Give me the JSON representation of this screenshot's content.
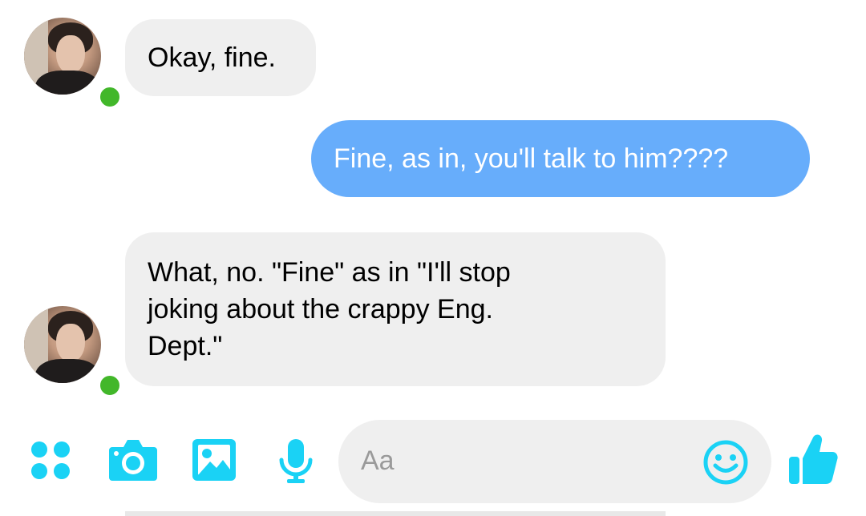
{
  "messages": [
    {
      "direction": "in",
      "text": "Okay, fine."
    },
    {
      "direction": "out",
      "text": "Fine, as in, you'll talk to him????"
    },
    {
      "direction": "in",
      "text": "What, no. \"Fine\" as in \"I'll stop\njoking about the crappy Eng.\nDept.\""
    }
  ],
  "composer": {
    "placeholder": "Aa",
    "icons": [
      "more-apps-icon",
      "camera-icon",
      "gallery-icon",
      "microphone-icon",
      "emoji-icon",
      "thumbs-up-icon"
    ]
  },
  "colors": {
    "accent": "#1ad2f5",
    "outgoing_bubble": "#67adfb",
    "incoming_bubble": "#efefef",
    "online_status": "#42b72a"
  }
}
